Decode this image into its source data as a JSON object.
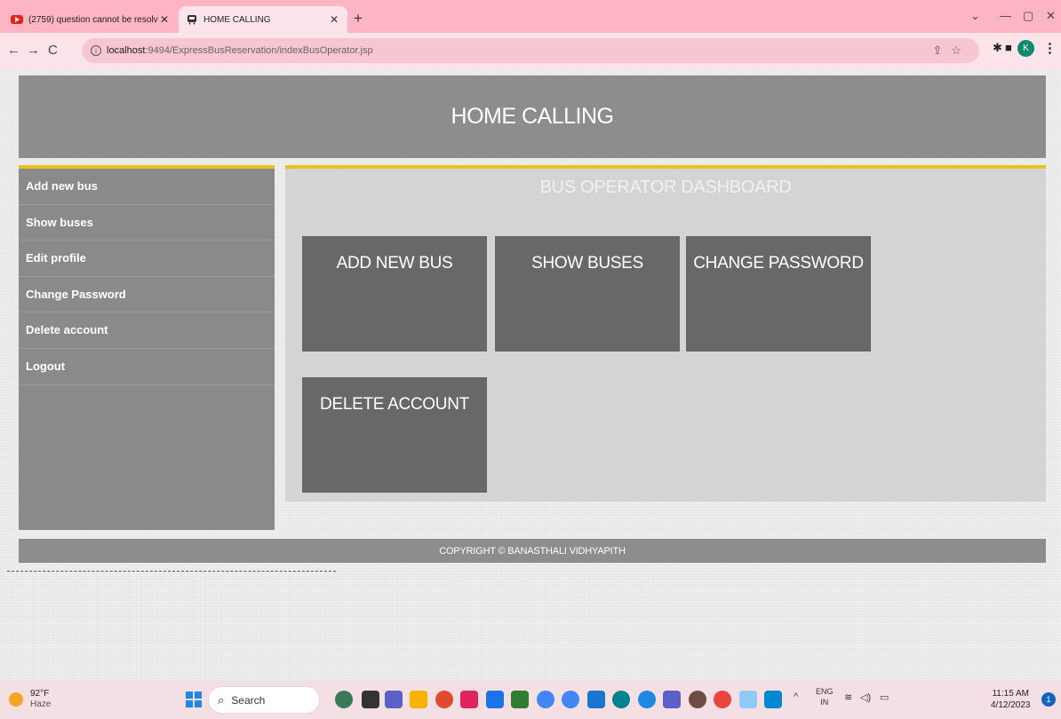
{
  "browser": {
    "tabs": [
      {
        "title": "(2759) question cannot be resolv",
        "icon": "youtube-icon",
        "active": false
      },
      {
        "title": "HOME CALLING",
        "icon": "bus-icon",
        "active": true
      }
    ],
    "url_host": "localhost",
    "url_path": ":9494/ExpressBusReservation/indexBusOperator.jsp",
    "profile_initial": "K"
  },
  "page": {
    "header": "HOME CALLING",
    "sidebar": {
      "items": [
        {
          "label": "Add new bus"
        },
        {
          "label": "Show buses"
        },
        {
          "label": "Edit profile"
        },
        {
          "label": "Change Password"
        },
        {
          "label": "Delete account"
        },
        {
          "label": "Logout"
        }
      ]
    },
    "dashboard": {
      "title": "BUS OPERATOR DASHBOARD",
      "cards": [
        {
          "label": "ADD NEW BUS"
        },
        {
          "label": "SHOW BUSES"
        },
        {
          "label": "CHANGE PASSWORD"
        },
        {
          "label": "DELETE ACCOUNT"
        }
      ]
    },
    "footer": "COPYRIGHT © BANASTHALI VIDHYAPITH"
  },
  "taskbar": {
    "weather_temp": "92°F",
    "weather_desc": "Haze",
    "search_label": "Search",
    "lang_top": "ENG",
    "lang_bottom": "IN",
    "time": "11:15 AM",
    "date": "4/12/2023",
    "notification_count": "1"
  },
  "colors": {
    "accent": "#e8c21a",
    "panel": "#8d8d8d",
    "card": "#686868",
    "chrome": "#fdb4c3"
  }
}
